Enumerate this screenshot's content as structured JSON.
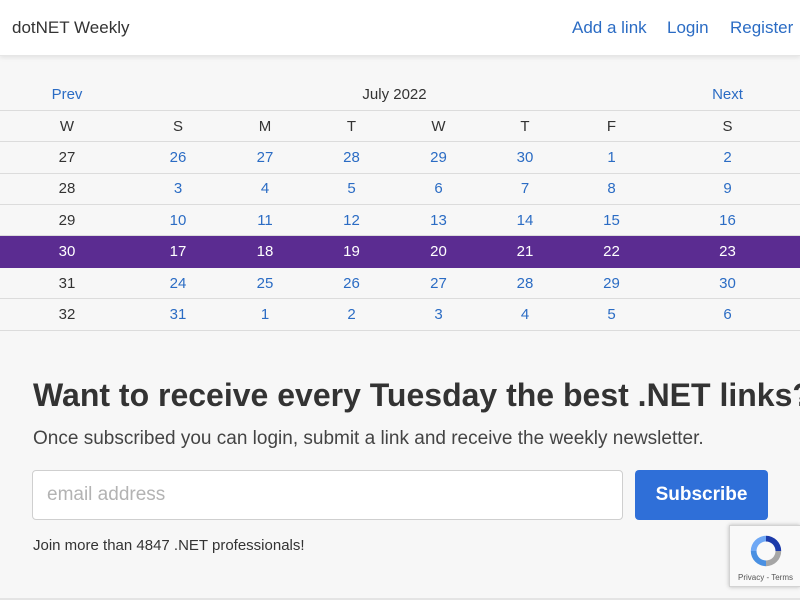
{
  "navbar": {
    "brand": "dotNET Weekly",
    "links": [
      "Add a link",
      "Login",
      "Register"
    ]
  },
  "calendar": {
    "prev": "Prev",
    "title": "July 2022",
    "next": "Next",
    "headers": [
      "W",
      "S",
      "M",
      "T",
      "W",
      "T",
      "F",
      "S"
    ],
    "weeks": [
      {
        "week": "27",
        "days": [
          "26",
          "27",
          "28",
          "29",
          "30",
          "1",
          "2"
        ]
      },
      {
        "week": "28",
        "days": [
          "3",
          "4",
          "5",
          "6",
          "7",
          "8",
          "9"
        ]
      },
      {
        "week": "29",
        "days": [
          "10",
          "11",
          "12",
          "13",
          "14",
          "15",
          "16"
        ]
      },
      {
        "week": "30",
        "days": [
          "17",
          "18",
          "19",
          "20",
          "21",
          "22",
          "23"
        ],
        "highlighted": true
      },
      {
        "week": "31",
        "days": [
          "24",
          "25",
          "26",
          "27",
          "28",
          "29",
          "30"
        ]
      },
      {
        "week": "32",
        "days": [
          "31",
          "1",
          "2",
          "3",
          "4",
          "5",
          "6"
        ]
      }
    ],
    "highlight_color": "#5b2c91"
  },
  "subscribe": {
    "title": "Want to receive every Tuesday the best .NET links?",
    "description": "Once subscribed you can login, submit a link and receive the weekly newsletter.",
    "email_placeholder": "email address",
    "button_label": "Subscribe",
    "join_text": "Join more than 4847 .NET professionals!"
  },
  "recaptcha": {
    "icon": "recaptcha-icon",
    "privacy": "Privacy",
    "separator": " - ",
    "terms": "Terms"
  },
  "colors": {
    "link": "#2b6cc4",
    "button": "#2f6fd8"
  }
}
